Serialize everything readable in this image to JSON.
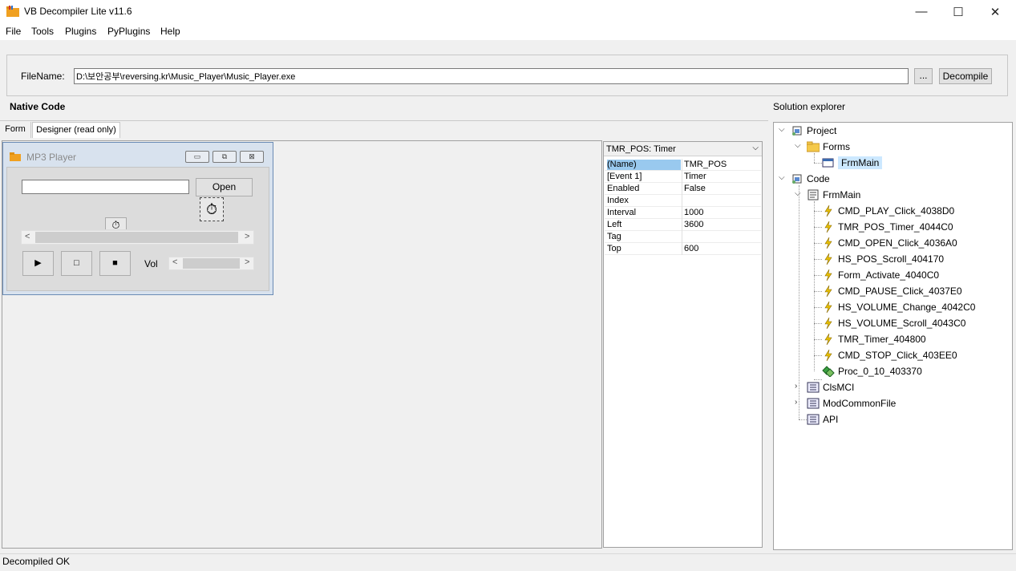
{
  "app": {
    "title": "VB Decompiler Lite v11.6",
    "icon": "folder-app-icon"
  },
  "window_controls": {
    "minimize": "—",
    "maximize": "☐",
    "close": "✕"
  },
  "menu": {
    "items": [
      "File",
      "Tools",
      "Plugins",
      "PyPlugins",
      "Help"
    ]
  },
  "file_bar": {
    "label": "FileName:",
    "value": "D:\\보안공부\\reversing.kr\\Music_Player\\Music_Player.exe",
    "browse_label": "...",
    "decompile_label": "Decompile"
  },
  "native_code": {
    "title": "Native Code",
    "tabs": [
      "Form",
      "Designer (read only)"
    ],
    "active_tab": "Designer (read only)"
  },
  "designer": {
    "form_title": "MP3 Player",
    "open_label": "Open",
    "vol_label": "Vol",
    "play_glyph": "▶",
    "stop_glyph": "□",
    "pause_glyph": "■",
    "timer_glyph": "⏱"
  },
  "properties": {
    "header": "TMR_POS: Timer",
    "rows": [
      {
        "name": "(Name)",
        "value": "TMR_POS"
      },
      {
        "name": "[Event 1]",
        "value": "Timer"
      },
      {
        "name": "Enabled",
        "value": "False"
      },
      {
        "name": "Index",
        "value": ""
      },
      {
        "name": "Interval",
        "value": "1000"
      },
      {
        "name": "Left",
        "value": "3600"
      },
      {
        "name": "Tag",
        "value": ""
      },
      {
        "name": "Top",
        "value": "600"
      }
    ]
  },
  "solution_explorer": {
    "title": "Solution explorer",
    "project": "Project",
    "forms": "Forms",
    "form_item": "FrmMain",
    "code": "Code",
    "code_module": "FrmMain",
    "procedures": [
      "CMD_PLAY_Click_4038D0",
      "TMR_POS_Timer_4044C0",
      "CMD_OPEN_Click_4036A0",
      "HS_POS_Scroll_404170",
      "Form_Activate_4040C0",
      "CMD_PAUSE_Click_4037E0",
      "HS_VOLUME_Change_4042C0",
      "HS_VOLUME_Scroll_4043C0",
      "TMR_Timer_404800",
      "CMD_STOP_Click_403EE0"
    ],
    "proc_item": "Proc_0_10_403370",
    "modules": [
      "ClsMCI",
      "ModCommonFile",
      "API"
    ]
  },
  "status": {
    "text": "Decompiled OK"
  },
  "colors": {
    "selection": "#cce8ff",
    "prop_selection": "#99c9ef",
    "event_icon": "#c8a000"
  }
}
